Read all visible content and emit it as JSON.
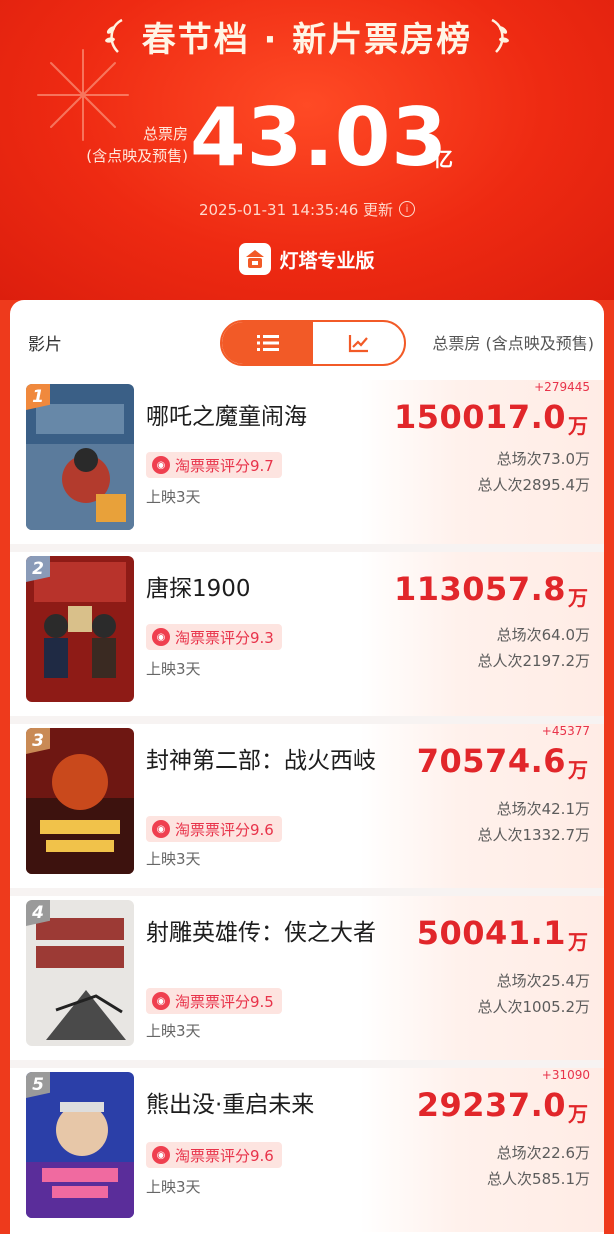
{
  "header": {
    "title": "春节档 · 新片票房榜",
    "total_label_line1": "总票房",
    "total_label_line2": "(含点映及预售)",
    "total_value": "43.03",
    "total_unit": "亿",
    "updated": "2025-01-31 14:35:46 更新",
    "brand": "灯塔专业版"
  },
  "list_header": {
    "left_label": "影片",
    "right_label": "总票房 (含点映及预售)",
    "view_toggle": [
      "list-icon",
      "chart-icon"
    ]
  },
  "colors": {
    "accent": "#f25a27",
    "price": "#e1262a",
    "background": "#ee3a1c"
  },
  "movies": [
    {
      "rank": "1",
      "rank_color": "#f0893d",
      "title": "哪吒之魔童闹海",
      "rating": "淘票票评分9.7",
      "days": "上映3天",
      "delta": "+279445",
      "box_office": "150017.0",
      "unit": "万",
      "shows": "总场次73.0万",
      "admissions": "总人次2895.4万"
    },
    {
      "rank": "2",
      "rank_color": "#8a9bb8",
      "title": "唐探1900",
      "rating": "淘票票评分9.3",
      "days": "上映3天",
      "delta": "",
      "box_office": "113057.8",
      "unit": "万",
      "shows": "总场次64.0万",
      "admissions": "总人次2197.2万"
    },
    {
      "rank": "3",
      "rank_color": "#c98a55",
      "title": "封神第二部：战火西岐",
      "rating": "淘票票评分9.6",
      "days": "上映3天",
      "delta": "+45377",
      "box_office": "70574.6",
      "unit": "万",
      "shows": "总场次42.1万",
      "admissions": "总人次1332.7万"
    },
    {
      "rank": "4",
      "rank_color": "#9a9a9a",
      "title": "射雕英雄传：侠之大者",
      "rating": "淘票票评分9.5",
      "days": "上映3天",
      "delta": "",
      "box_office": "50041.1",
      "unit": "万",
      "shows": "总场次25.4万",
      "admissions": "总人次1005.2万"
    },
    {
      "rank": "5",
      "rank_color": "#9a9a9a",
      "title": "熊出没·重启未来",
      "rating": "淘票票评分9.6",
      "days": "上映3天",
      "delta": "+31090",
      "box_office": "29237.0",
      "unit": "万",
      "shows": "总场次22.6万",
      "admissions": "总人次585.1万"
    }
  ]
}
